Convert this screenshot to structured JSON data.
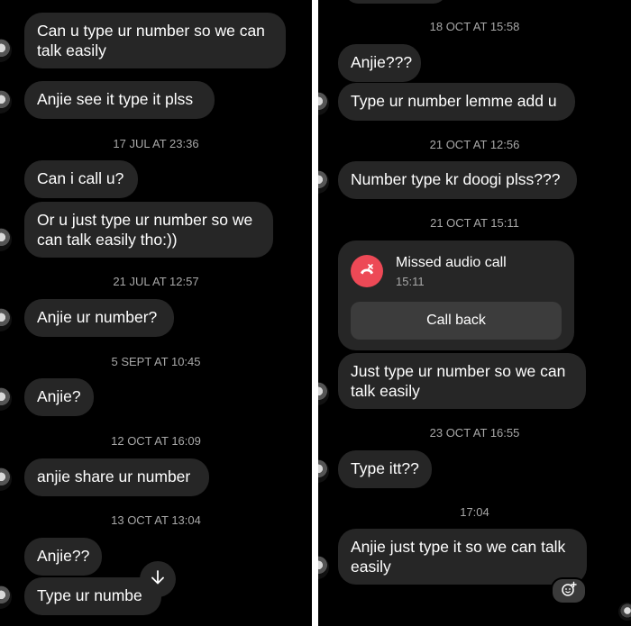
{
  "left": {
    "messages": [
      {
        "text": "Can u type ur number so we can\ntalk easily"
      },
      {
        "text": "Anjie see it type it plss"
      },
      {
        "text": "Can i call u?"
      },
      {
        "text": "Or u just type ur number so we\ncan talk easily tho:))"
      },
      {
        "text": "Anjie ur number?"
      },
      {
        "text": "Anjie?"
      },
      {
        "text": "anjie share ur number"
      },
      {
        "text": "Anjie??"
      },
      {
        "text": "Type ur numbe"
      }
    ],
    "timestamps": [
      "17 JUL AT 23:36",
      "21 JUL AT 12:57",
      "5 SEPT AT 10:45",
      "12 OCT AT 16:09",
      "13 OCT AT 13:04"
    ]
  },
  "right": {
    "messages": [
      {
        "text": "Anjie???"
      },
      {
        "text": "Type ur number lemme add u"
      },
      {
        "text": "Number type kr doogi plss???"
      },
      {
        "text": "Just type ur number so we can\ntalk easily"
      },
      {
        "text": "Type itt??"
      },
      {
        "text": "Anjie just type it so we can talk\neasily"
      }
    ],
    "timestamps": [
      "18 OCT AT 15:58",
      "21 OCT AT 12:56",
      "21 OCT AT 15:11",
      "23 OCT AT 16:55",
      "17:04"
    ],
    "call": {
      "title": "Missed audio call",
      "time": "15:11",
      "button": "Call back"
    }
  },
  "colors": {
    "background": "#000000",
    "bubble": "#262626",
    "timestamp": "#a8a8a8",
    "missed_call": "#ed4956"
  },
  "icons": {
    "missed_call": "phone-missed-icon",
    "scroll": "arrow-down-icon",
    "reaction": "add-reaction-icon"
  }
}
